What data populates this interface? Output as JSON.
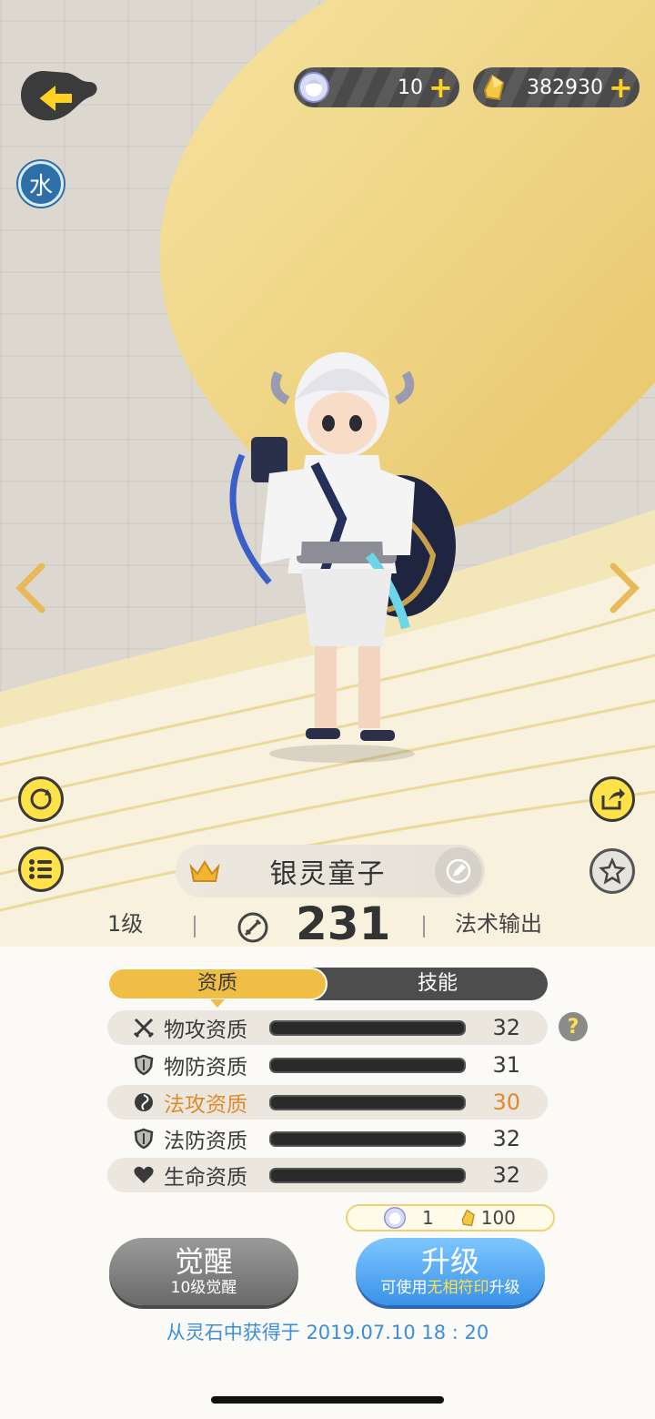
{
  "header": {
    "element_badge": "水",
    "currency": [
      {
        "icon": "spirit-avatar-icon",
        "value": "10",
        "plus": "+"
      },
      {
        "icon": "gold-crystal-icon",
        "value": "382930",
        "plus": "+"
      }
    ]
  },
  "pet": {
    "name": "银灵童子",
    "level": "1级",
    "power": "231",
    "role": "法术输出"
  },
  "tabs": [
    {
      "label": "资质",
      "active": true
    },
    {
      "label": "技能",
      "active": false
    }
  ],
  "attributes": [
    {
      "icon": "crossed-swords-icon",
      "label": "物攻资质",
      "value": "32",
      "fill": 1.0,
      "highlight": false
    },
    {
      "icon": "shield-icon",
      "label": "物防资质",
      "value": "31",
      "fill": 0.97,
      "highlight": false
    },
    {
      "icon": "magic-orb-icon",
      "label": "法攻资质",
      "value": "30",
      "fill": 0.94,
      "highlight": true
    },
    {
      "icon": "shield-icon",
      "label": "法防资质",
      "value": "32",
      "fill": 1.0,
      "highlight": false
    },
    {
      "icon": "heart-icon",
      "label": "生命资质",
      "value": "32",
      "fill": 1.0,
      "highlight": false
    }
  ],
  "help_label": "?",
  "cost": {
    "spirit": "1",
    "gold": "100"
  },
  "buttons": {
    "awaken": {
      "title": "觉醒",
      "subtitle": "10级觉醒"
    },
    "upgrade": {
      "title": "升级",
      "sub_prefix": "可使用",
      "sub_highlight": "无相符印",
      "sub_suffix": "升级"
    }
  },
  "obtained_text": "从灵石中获得于 2019.07.10   18 : 20",
  "colors": {
    "gold": "#f0bd45",
    "highlight": "#e08a2a",
    "blue": "#3a8ee0",
    "yellow": "#ffe14a"
  }
}
